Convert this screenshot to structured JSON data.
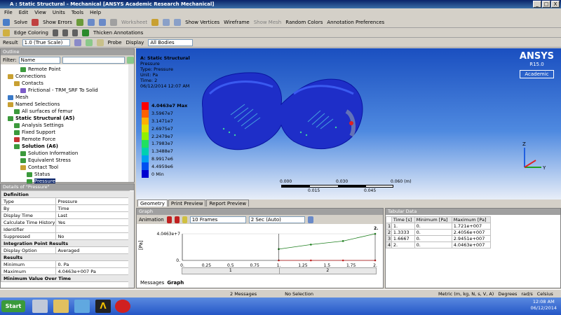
{
  "window": {
    "title": "A : Static Structural - Mechanical [ANSYS Academic Research Mechanical]",
    "min": "_",
    "max": "□",
    "close": "X"
  },
  "menu": [
    "File",
    "Edit",
    "View",
    "Units",
    "Tools",
    "Help"
  ],
  "toolbar1": {
    "solve": "Solve",
    "show_errors": "Show Errors",
    "worksheet": "Worksheet",
    "show_vertices": "Show Vertices",
    "wireframe": "Wireframe",
    "show_mesh": "Show Mesh",
    "random_colors": "Random Colors",
    "annotation_prefs": "Annotation Preferences"
  },
  "toolbar2": {
    "edge_coloring": "Edge Coloring",
    "thicken": "Thicken Annotations"
  },
  "toolbar3": {
    "result_label": "Result",
    "scale_value": "1.0 (True Scale)",
    "probe": "Probe",
    "display_label": "Display",
    "display_value": "All Bodies"
  },
  "outline": {
    "header": "Outline",
    "filter_label": "Filter:",
    "filter_value": "Name",
    "items": [
      {
        "label": "Remote Point",
        "indent": 4,
        "color": "#3c9a3c",
        "bold": false
      },
      {
        "label": "Connections",
        "indent": 2,
        "color": "#c8a032",
        "bold": false
      },
      {
        "label": "Contacts",
        "indent": 3,
        "color": "#c8a032",
        "bold": false
      },
      {
        "label": "Frictional - TRM_SRF To Solid",
        "indent": 4,
        "color": "#7c5cc8",
        "bold": false
      },
      {
        "label": "Mesh",
        "indent": 2,
        "color": "#3a7ac8",
        "bold": false
      },
      {
        "label": "Named Selections",
        "indent": 2,
        "color": "#c8a032",
        "bold": false
      },
      {
        "label": "All surfaces of femur",
        "indent": 3,
        "color": "#3c9a3c",
        "bold": false
      },
      {
        "label": "Static Structural (A5)",
        "indent": 2,
        "color": "#3c9a3c",
        "bold": true
      },
      {
        "label": "Analysis Settings",
        "indent": 3,
        "color": "#3c9a3c",
        "bold": false
      },
      {
        "label": "Fixed Support",
        "indent": 3,
        "color": "#3c9a3c",
        "bold": false
      },
      {
        "label": "Remote Force",
        "indent": 3,
        "color": "#c83232",
        "bold": false
      },
      {
        "label": "Solution (A6)",
        "indent": 3,
        "color": "#3c9a3c",
        "bold": true
      },
      {
        "label": "Solution Information",
        "indent": 4,
        "color": "#3c9a3c",
        "bold": false
      },
      {
        "label": "Equivalent Stress",
        "indent": 4,
        "color": "#3c9a3c",
        "bold": false
      },
      {
        "label": "Contact Tool",
        "indent": 4,
        "color": "#c8a032",
        "bold": false
      },
      {
        "label": "Status",
        "indent": 5,
        "color": "#3c9a3c",
        "bold": false
      },
      {
        "label": "Pressure",
        "indent": 5,
        "color": "#3c9a3c",
        "bold": false
      }
    ]
  },
  "details": {
    "header": "Details of \"Pressure\"",
    "rows": [
      {
        "group": "Definition"
      },
      {
        "k": "Type",
        "v": "Pressure"
      },
      {
        "k": "By",
        "v": "Time"
      },
      {
        "k": "Display Time",
        "v": "Last"
      },
      {
        "k": "Calculate Time History",
        "v": "Yes"
      },
      {
        "k": "Identifier",
        "v": ""
      },
      {
        "k": "Suppressed",
        "v": "No"
      },
      {
        "group": "Integration Point Results"
      },
      {
        "k": "Display Option",
        "v": "Averaged"
      },
      {
        "group": "Results"
      },
      {
        "k": "Minimum",
        "v": "0. Pa"
      },
      {
        "k": "Maximum",
        "v": "4.0463e+007 Pa"
      },
      {
        "group": "Minimum Value Over Time"
      }
    ]
  },
  "viewport": {
    "title": "A: Static Structural",
    "line2": "Pressure",
    "line3": "Type: Pressure",
    "line4": "Unit: Pa",
    "line5": "Time: 2",
    "line6": "06/12/2014 12:07 AM",
    "brand": "ANSYS",
    "version": "R15.0",
    "edition": "Academic",
    "legend": [
      {
        "label": "4.0463e7 Max",
        "color": "#ff0000"
      },
      {
        "label": "3.5967e7",
        "color": "#ff6000"
      },
      {
        "label": "3.1471e7",
        "color": "#ffb000"
      },
      {
        "label": "2.6975e7",
        "color": "#e0e000"
      },
      {
        "label": "2.2479e7",
        "color": "#90f000"
      },
      {
        "label": "1.7983e7",
        "color": "#20e060"
      },
      {
        "label": "1.3488e7",
        "color": "#00d0b0"
      },
      {
        "label": "8.9917e6",
        "color": "#00a0f0"
      },
      {
        "label": "4.4959e6",
        "color": "#0050f0"
      },
      {
        "label": "0 Min",
        "color": "#0000d0"
      }
    ],
    "scale": {
      "t0": "0.000",
      "t1": "0.030",
      "t2": "0.060 (m)",
      "t3": "0.015",
      "t4": "0.045"
    },
    "axes": {
      "z": "Z",
      "y": "Y"
    },
    "tabs": [
      "Geometry",
      "Print Preview",
      "Report Preview"
    ]
  },
  "graph": {
    "header": "Graph",
    "animation": "Animation",
    "frames": "10 Frames",
    "duration": "2 Sec (Auto)",
    "ylabel": "[Pa]",
    "ymax": "4.0463e+7",
    "yzero": "0.",
    "xlabel": "[s]",
    "xticks": [
      "0.",
      "0.25",
      "0.5",
      "0.75",
      "1.",
      "1.25",
      "1.5",
      "1.75",
      "2."
    ],
    "step_labels": [
      "1",
      "2"
    ],
    "corner": "2.",
    "tabs": [
      "Messages",
      "Graph"
    ]
  },
  "tabular": {
    "header": "Tabular Data",
    "columns": [
      "Time [s]",
      "Minimum [Pa]",
      "Maximum [Pa]"
    ],
    "rows": [
      [
        "1",
        "1.",
        "0.",
        "1.721e+007"
      ],
      [
        "2",
        "1.3333",
        "0.",
        "2.4056e+007"
      ],
      [
        "3",
        "1.6667",
        "0.",
        "2.9451e+007"
      ],
      [
        "4",
        "2.",
        "0.",
        "4.0463e+007"
      ]
    ]
  },
  "chart_data": {
    "type": "line",
    "x": [
      1.0,
      1.3333,
      1.6667,
      2.0
    ],
    "series": [
      {
        "name": "Minimum [Pa]",
        "values": [
          0,
          0,
          0,
          0
        ]
      },
      {
        "name": "Maximum [Pa]",
        "values": [
          17210000,
          24056000,
          29451000,
          40463000
        ]
      }
    ],
    "xlim": [
      0,
      2
    ],
    "ylim": [
      0,
      40463000
    ],
    "xlabel": "[s]",
    "ylabel": "[Pa]"
  },
  "status": {
    "messages": "2 Messages",
    "selection": "No Selection",
    "units": "Metric (m, kg, N, s, V, A)",
    "degrees": "Degrees",
    "rads": "rad/s",
    "celsius": "Celsius"
  },
  "taskbar": {
    "start": "Start",
    "time": "12:08 AM",
    "date": "06/12/2014"
  }
}
